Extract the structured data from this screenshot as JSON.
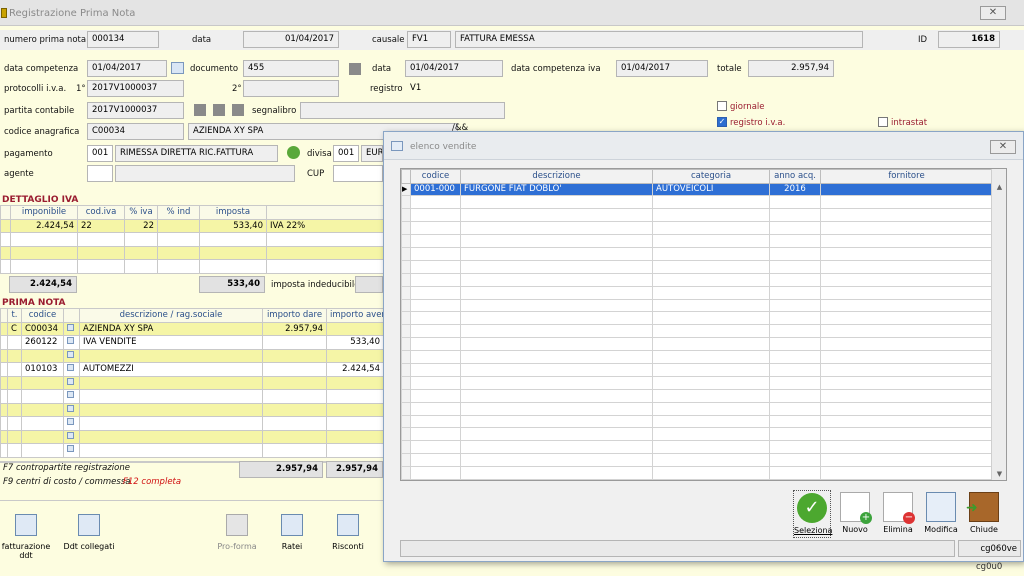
{
  "window": {
    "title": "Registrazione Prima Nota",
    "close": "✕"
  },
  "header": {
    "numero_label": "numero prima nota",
    "numero": "000134",
    "data_label": "data",
    "data": "01/04/2017",
    "causale_label": "causale",
    "causale_code": "FV1",
    "causale_desc": "FATTURA EMESSA",
    "id_label": "ID",
    "id": "1618"
  },
  "row2": {
    "competenza_label": "data competenza",
    "competenza": "01/04/2017",
    "documento_label": "documento",
    "documento": "455",
    "data_label": "data",
    "data": "01/04/2017",
    "competenza_iva_label": "data competenza iva",
    "competenza_iva": "01/04/2017",
    "totale_label": "totale",
    "totale": "2.957,94"
  },
  "row3": {
    "protocolli_label": "protocolli i.v.a.",
    "p1_label": "1°",
    "p1": "2017V1000037",
    "p2_label": "2°",
    "p2": "",
    "registro_label": "registro",
    "registro": "V1"
  },
  "row4": {
    "partita_label": "partita contabile",
    "partita": "2017V1000037",
    "segnalibro_label": "segnalibro",
    "segnalibro": "",
    "giornale": "giornale",
    "registro_iva": "registro i.v.a.",
    "intrastat": "intrastat"
  },
  "row5": {
    "anagrafica_label": "codice anagrafica",
    "anagrafica_code": "C00034",
    "anagrafica_name": "AZIENDA XY SPA",
    "extra": "/&&"
  },
  "row6": {
    "pagamento_label": "pagamento",
    "pagamento_code": "001",
    "pagamento_desc": "RIMESSA DIRETTA RIC.FATTURA",
    "divisa_label": "divisa",
    "divisa_code": "001",
    "divisa_desc": "EURO"
  },
  "row7": {
    "agente_label": "agente",
    "agente": "",
    "cup_label": "CUP",
    "cup": ""
  },
  "iva": {
    "title": "DETTAGLIO IVA",
    "headers": [
      "imponibile",
      "cod.iva",
      "% iva",
      "% ind",
      "imposta",
      ""
    ],
    "rows": [
      [
        "2.424,54",
        "22",
        "22",
        "",
        "533,40",
        "IVA 22%"
      ],
      [
        "",
        "",
        "",
        "",
        "",
        ""
      ],
      [
        "",
        "",
        "",
        "",
        "",
        ""
      ],
      [
        "",
        "",
        "",
        "",
        "",
        ""
      ]
    ],
    "tot_imponibile": "2.424,54",
    "tot_imposta": "533,40",
    "indeducibile_label": "imposta indeducibile"
  },
  "prima": {
    "title": "PRIMA NOTA",
    "headers": [
      "t.",
      "codice",
      "",
      "descrizione / rag.sociale",
      "importo dare",
      "importo avere"
    ],
    "rows": [
      [
        "C",
        "C00034",
        "AZIENDA XY SPA",
        "2.957,94",
        ""
      ],
      [
        "",
        "260122",
        "IVA VENDITE",
        "",
        "533,40"
      ],
      [
        "",
        "",
        "",
        "",
        ""
      ],
      [
        "",
        "010103",
        "AUTOMEZZI",
        "",
        "2.424,54"
      ],
      [
        "",
        "",
        "",
        "",
        ""
      ],
      [
        "",
        "",
        "",
        "",
        ""
      ],
      [
        "",
        "",
        "",
        "",
        ""
      ],
      [
        "",
        "",
        "",
        "",
        ""
      ],
      [
        "",
        "",
        "",
        "",
        ""
      ],
      [
        "",
        "",
        "",
        "",
        ""
      ]
    ],
    "tot_dare": "2.957,94",
    "tot_avere": "2.957,94",
    "f7": "F7 contropartite registrazione",
    "f9": "F9 centri di costo / commessa",
    "f12": "F12 completa"
  },
  "toolbar": [
    "fatturazione ddt",
    "Ddt collegati",
    "Pro-forma",
    "Ratei",
    "Risconti"
  ],
  "popup": {
    "title": "elenco vendite",
    "close": "✕",
    "headers": [
      "codice",
      "descrizione",
      "categoria",
      "anno acq.",
      "fornitore"
    ],
    "rows": [
      [
        "0001-000",
        "FURGONE FIAT DOBLO'",
        "AUTOVEICOLI",
        "2016",
        ""
      ]
    ],
    "buttons": [
      "Seleziona",
      "Nuovo",
      "Elimina",
      "Modifica",
      "Chiude"
    ],
    "status_code": "cg060ve"
  },
  "status_bottom": "cg0u0",
  "colors": {
    "accent": "#9a1c30",
    "selection": "#2e6fd5",
    "yellow_row": "#f5f5a6"
  }
}
